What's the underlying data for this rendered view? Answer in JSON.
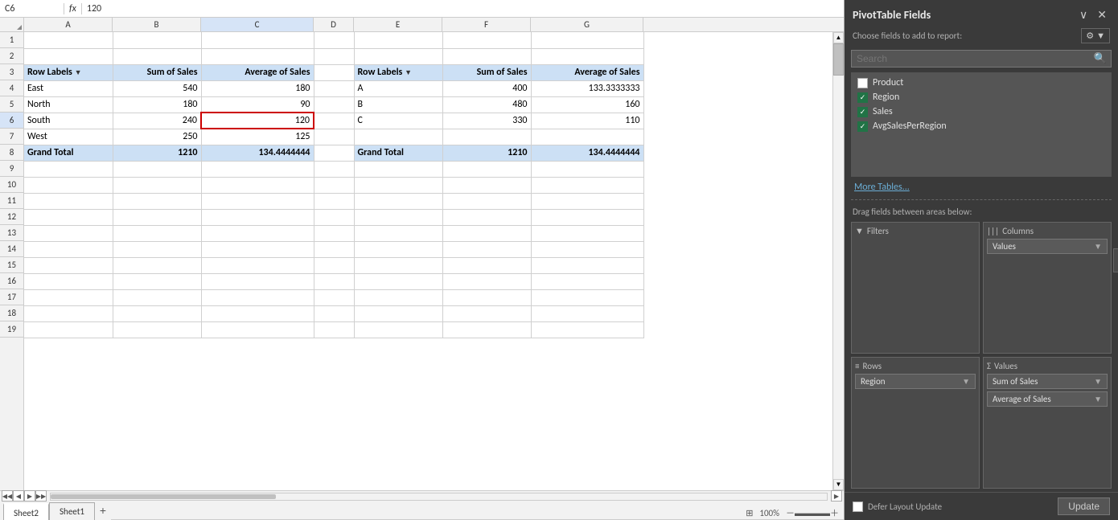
{
  "spreadsheet": {
    "name_box": "C6",
    "formula_bar": "120",
    "col_headers": [
      "",
      "A",
      "B",
      "C",
      "D",
      "E",
      "F",
      "G"
    ],
    "rows": [
      {
        "num": 1,
        "cells": [
          "",
          "",
          "",
          "",
          "",
          "",
          "",
          ""
        ]
      },
      {
        "num": 2,
        "cells": [
          "",
          "",
          "",
          "",
          "",
          "",
          "",
          ""
        ]
      },
      {
        "num": 3,
        "cells": [
          "",
          "Row Labels",
          "Sum of Sales",
          "Average of Sales",
          "",
          "Row Labels",
          "Sum of Sales",
          "Average of Sales"
        ],
        "type": "header"
      },
      {
        "num": 4,
        "cells": [
          "",
          "East",
          "540",
          "180",
          "",
          "A",
          "400",
          "133.3333333"
        ],
        "type": "data"
      },
      {
        "num": 5,
        "cells": [
          "",
          "North",
          "180",
          "90",
          "",
          "B",
          "480",
          "160"
        ],
        "type": "data"
      },
      {
        "num": 6,
        "cells": [
          "",
          "South",
          "240",
          "120",
          "",
          "C",
          "330",
          "110"
        ],
        "type": "data",
        "selected_col": 3
      },
      {
        "num": 7,
        "cells": [
          "",
          "West",
          "250",
          "125",
          "",
          "",
          "",
          ""
        ],
        "type": "data"
      },
      {
        "num": 8,
        "cells": [
          "",
          "Grand Total",
          "1210",
          "134.4444444",
          "",
          "Grand Total",
          "1210",
          "134.4444444"
        ],
        "type": "grandtotal"
      },
      {
        "num": 9,
        "cells": [
          "",
          "",
          "",
          "",
          "",
          "",
          "",
          ""
        ]
      },
      {
        "num": 10,
        "cells": [
          "",
          "",
          "",
          "",
          "",
          "",
          "",
          ""
        ]
      },
      {
        "num": 11,
        "cells": [
          "",
          "",
          "",
          "",
          "",
          "",
          "",
          ""
        ]
      },
      {
        "num": 12,
        "cells": [
          "",
          "",
          "",
          "",
          "",
          "",
          "",
          ""
        ]
      },
      {
        "num": 13,
        "cells": [
          "",
          "",
          "",
          "",
          "",
          "",
          "",
          ""
        ]
      },
      {
        "num": 14,
        "cells": [
          "",
          "",
          "",
          "",
          "",
          "",
          "",
          ""
        ]
      },
      {
        "num": 15,
        "cells": [
          "",
          "",
          "",
          "",
          "",
          "",
          "",
          ""
        ]
      },
      {
        "num": 16,
        "cells": [
          "",
          "",
          "",
          "",
          "",
          "",
          "",
          ""
        ]
      },
      {
        "num": 17,
        "cells": [
          "",
          "",
          "",
          "",
          "",
          "",
          "",
          ""
        ]
      },
      {
        "num": 18,
        "cells": [
          "",
          "",
          "",
          "",
          "",
          "",
          "",
          ""
        ]
      },
      {
        "num": 19,
        "cells": [
          "",
          "",
          "",
          "",
          "",
          "",
          "",
          ""
        ]
      }
    ],
    "sheets": [
      "Sheet2",
      "Sheet1"
    ]
  },
  "pivot_panel": {
    "title": "PivotTable Fields",
    "choose_fields_label": "Choose fields to add to report:",
    "search_placeholder": "Search",
    "fields": [
      {
        "name": "Product",
        "checked": false
      },
      {
        "name": "Region",
        "checked": true
      },
      {
        "name": "Sales",
        "checked": true
      },
      {
        "name": "AvgSalesPerRegion",
        "checked": true
      }
    ],
    "more_tables": "More Tables...",
    "drag_fields_label": "Drag fields between areas below:",
    "areas": {
      "filters": {
        "title": "Filters",
        "icon": "▼",
        "items": []
      },
      "columns": {
        "title": "Columns",
        "icon": "|||",
        "items": [
          "Values"
        ]
      },
      "rows": {
        "title": "Rows",
        "icon": "≡",
        "items": [
          "Region"
        ]
      },
      "values": {
        "title": "Values",
        "icon": "Σ",
        "items": [
          "Sum of Sales",
          "Average of Sales"
        ]
      }
    },
    "defer_layout_update": "Defer Layout Update",
    "update_button": "Update"
  }
}
